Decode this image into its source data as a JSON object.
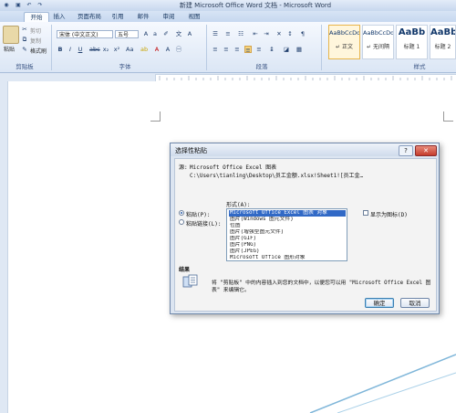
{
  "window": {
    "title": "新建 Microsoft Office Word 文档 - Microsoft Word"
  },
  "ribbon": {
    "tabs": [
      "开始",
      "插入",
      "页面布局",
      "引用",
      "邮件",
      "审阅",
      "视图"
    ],
    "active_tab": "开始",
    "clipboard": {
      "paste_label": "粘贴",
      "cut_label": "剪切",
      "copy_label": "复制",
      "format_painter_label": "格式刷",
      "group_label": "剪贴板"
    },
    "font": {
      "font_name": "宋体 (中文正文)",
      "font_size": "五号",
      "group_label": "字体"
    },
    "paragraph": {
      "group_label": "段落"
    },
    "styles": {
      "items": [
        {
          "sample": "AaBbCcDd",
          "name": "↵ 正文"
        },
        {
          "sample": "AaBbCcDd",
          "name": "↵ 无间隔"
        },
        {
          "sample": "AaBb",
          "name": "标题 1"
        },
        {
          "sample": "AaBb",
          "name": "标题 2"
        }
      ],
      "group_label": "样式"
    }
  },
  "dialog": {
    "title": "选择性粘贴",
    "help_label": "?",
    "close_label": "✕",
    "source_label": "源:",
    "source_type": "Microsoft Office Excel 图表",
    "source_path": "C:\\Users\\tianling\\Desktop\\员工金额.xlsx!Sheet1![员工金…",
    "as_label": "形式(A):",
    "paste_option": "粘贴(P):",
    "paste_link_option": "粘贴链接(L):",
    "formats": [
      "Microsoft Office Excel 图表 对象",
      "图片(Windows 图元文件)",
      "位图",
      "图片(增强型图元文件)",
      "图片(GIF)",
      "图片(PNG)",
      "图片(JPEG)",
      "Microsoft Office 图形对象"
    ],
    "selected_format_index": 0,
    "display_as_icon_label": "显示为图标(D)",
    "result_label": "结果",
    "result_text_line1": "将 \"剪贴板\" 中的内容插入到您的文档中，以便您可以用 \"Microsoft Office Excel 图",
    "result_text_line2": "表\" 来编辑它。",
    "ok_label": "确定",
    "cancel_label": "取消"
  },
  "colors": {
    "selection": "#3169c6",
    "ribbon_bg": "#dbe6f5",
    "dialog_bg": "#dce5f1"
  }
}
